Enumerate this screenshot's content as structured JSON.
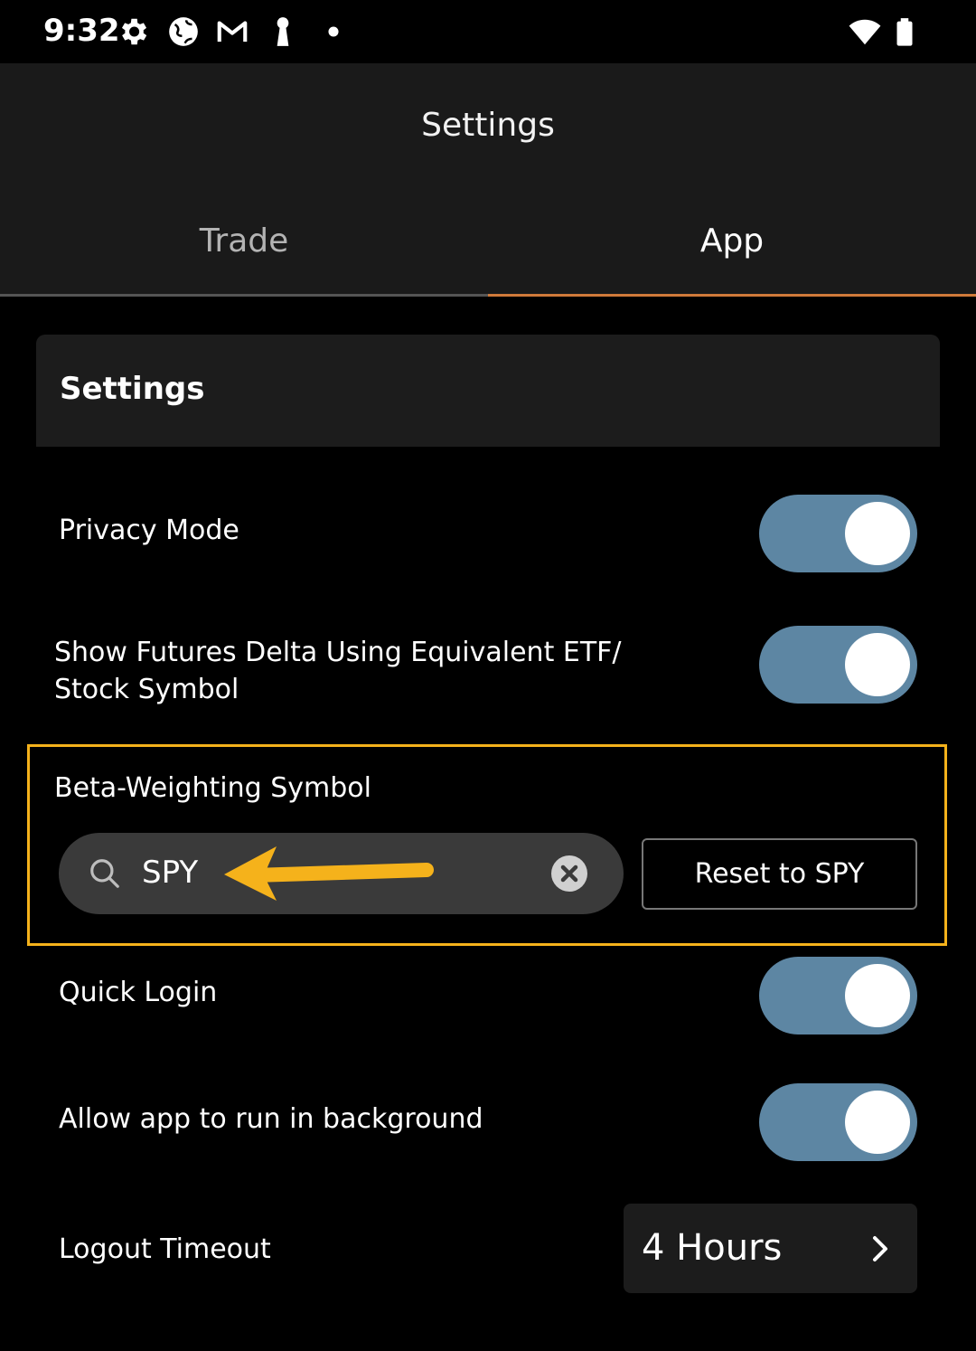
{
  "status_bar": {
    "time": "9:32",
    "icons": [
      "gear-icon",
      "globe-icon",
      "gmail-icon",
      "keyhole-icon",
      "dot-icon",
      "wifi-icon",
      "battery-icon"
    ]
  },
  "header": {
    "title": "Settings",
    "tabs": [
      {
        "label": "Trade",
        "active": false
      },
      {
        "label": "App",
        "active": true
      }
    ]
  },
  "section": {
    "title": "Settings"
  },
  "settings": {
    "privacy_mode": {
      "label": "Privacy Mode",
      "enabled": true
    },
    "futures_delta": {
      "label_line1": "Show Futures Delta Using Equivalent ETF/",
      "label_line2": "Stock Symbol",
      "enabled": true
    },
    "beta_weighting": {
      "label": "Beta-Weighting Symbol",
      "value": "SPY",
      "reset_label": "Reset to SPY"
    },
    "quick_login": {
      "label": "Quick Login",
      "enabled": true
    },
    "background": {
      "label": "Allow app to run in background",
      "enabled": true
    },
    "logout_timeout": {
      "label": "Logout Timeout",
      "value": "4 Hours"
    }
  },
  "colors": {
    "toggle_on": "#5d86a3",
    "highlight": "#f5b21b",
    "tab_underline": "#d07a3a",
    "arrow": "#f5b21b"
  }
}
